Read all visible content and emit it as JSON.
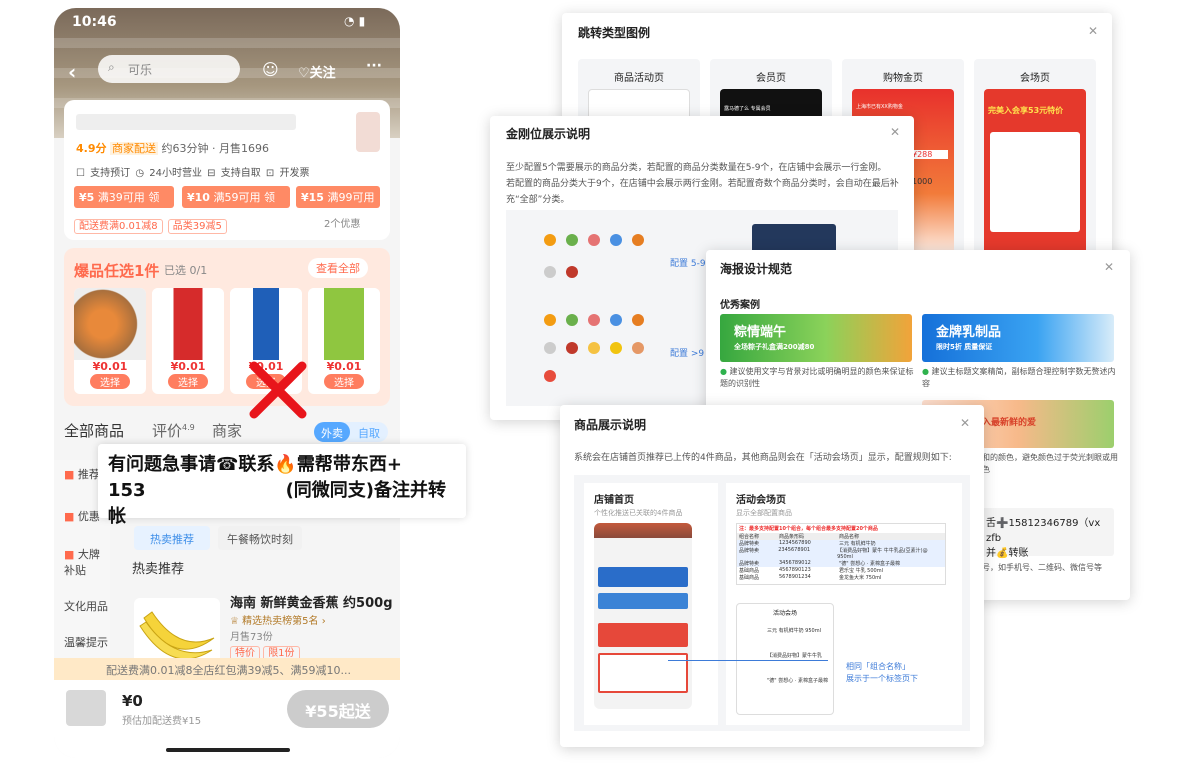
{
  "phone": {
    "time": "10:46",
    "search_text": "可乐",
    "follow": "关注",
    "rating": "4.9分",
    "delivery": "商家配送",
    "delivery_info": "约63分钟 · 月售1696",
    "features": [
      "支持预订",
      "24小时营业",
      "支持自取",
      "开发票"
    ],
    "coupons": [
      {
        "amt": "¥5",
        "cond": "满39可用",
        "act": "领"
      },
      {
        "amt": "¥10",
        "cond": "满59可用",
        "act": "领"
      },
      {
        "amt": "¥15",
        "cond": "满99可用",
        "act": ""
      }
    ],
    "tags": [
      "配送费满0.01减8",
      "品类39减5"
    ],
    "more_offers": "2个优惠",
    "hot_title": "爆品任选1件",
    "hot_selected": "已选 0/1",
    "hot_all": "查看全部",
    "products": [
      {
        "price": "¥0.01",
        "btn": "选择"
      },
      {
        "price": "¥0.01",
        "btn": "选择"
      },
      {
        "price": "¥0.01",
        "btn": "选择"
      },
      {
        "price": "¥0.01",
        "btn": "选择"
      }
    ],
    "tabs": [
      "全部商品",
      "评价",
      "商家"
    ],
    "review_score": "4.9",
    "toggle": [
      "外卖",
      "自取"
    ],
    "side": [
      "推荐",
      "优惠",
      "大牌补贴",
      "文化用品",
      "温馨提示"
    ],
    "chips": [
      "热卖推荐",
      "午餐畅饮时刻"
    ],
    "section": "热卖推荐",
    "item_name": "海南 新鲜黄金香蕉 约500g",
    "item_rank": "精选热卖榜第5名",
    "item_sales": "月售73份",
    "item_tags": [
      "特价",
      "限1份"
    ],
    "footer_promo": "配送费满0.01减8全店红包满39减5、满59减10...",
    "cart_price": "¥0",
    "cart_sub": "预估加配送费¥15",
    "cta": "¥55起送"
  },
  "overlay": {
    "line1": "有问题急事请☎联系🔥需帮带东西+",
    "line2_prefix": "153",
    "line2_suffix": "(同微同支)备注并转帐"
  },
  "jump": {
    "title": "跳转类型图例",
    "cards": [
      "商品活动页",
      "会员页",
      "购物金页",
      "会场页"
    ],
    "member_banner": "露马德了么 专属会员",
    "shop_text": "上海市已有XX购物金",
    "venue_text": "完美入会享53元特价",
    "p288": "¥288",
    "p1000": "1000"
  },
  "gold": {
    "title": "金刚位展示说明",
    "desc1": "至少配置5个需要展示的商品分类，若配置的商品分类数量在5-9个，在店铺中会展示一行金刚。",
    "desc2": "若配置的商品分类大于9个，在店铺中会展示两行金刚。若配置奇数个商品分类时，会自动在最后补充“全部”分类。",
    "label1": "配置 5-9 个",
    "label2": "配置 >9 个"
  },
  "poster": {
    "title": "海报设计规范",
    "subtitle": "优秀案例",
    "banner1_title": "粽情端午",
    "banner1_sub": "全场粽子礼盒满200减80",
    "banner2_title": "金牌乳制品",
    "banner2_sub": "限时5折 质量保证",
    "note1": "建议使用文字与背景对比或明确明显的颜色来保证标题的识别性",
    "note2": "建议主标题文案精简，副标题合理控制字数无赘述内容",
    "banner3_text": "入最新鲜的爱",
    "note3a": "和的颜色，避免颜色过于荧光刺眼或用",
    "note3b": "色",
    "contact1": "舌➕15812346789（vx zfb",
    "contact2": "并💰转账",
    "note4": "号，如手机号、二维码、微信号等"
  },
  "goods": {
    "title": "商品展示说明",
    "desc": "系统会在店铺首页推荐已上传的4件商品，其他商品则会在「活动会场页」显示，配置规则如下:",
    "left_title": "店铺首页",
    "left_sub": "个性化推送已关联的4件商品",
    "right_title": "活动会场页",
    "right_sub": "显示全部配置商品",
    "arrow_label1": "相同「组合名称」",
    "arrow_label2": "展示于一个标签页下",
    "sheet_header": "注：最多支持配置10个组合，每个组合最多支持配置20个商品",
    "sheet_cols": [
      "组合名称",
      "商品条形码",
      "商品名称"
    ],
    "sheet_rows": [
      [
        "品牌特卖",
        "1234567890",
        "三元 有机鲜牛奶"
      ],
      [
        "品牌特卖",
        "2345678901",
        "【消费品好物】蒙牛 牛牛乳品(豆素汁)@ 950ml"
      ],
      [
        "品牌特卖",
        "3456789012",
        "\"德\" 尝想心 · 素棉盒子最棉"
      ],
      [
        "基础商品",
        "4567890123",
        "君乐宝 牛乳 500ml"
      ],
      [
        "基础商品",
        "5678901234",
        "金龙鱼大米 750ml"
      ]
    ],
    "venue_name": "活动会场",
    "venue_items": [
      "三元 有机鲜牛奶 950ml",
      "【消费品好物】蒙牛牛乳",
      "\"德\" 尝想心 · 素棉盒子最棉"
    ]
  },
  "colors": {
    "accent": "#ff6a4d",
    "blue": "#3d7bd8",
    "green": "#2fb24e"
  }
}
